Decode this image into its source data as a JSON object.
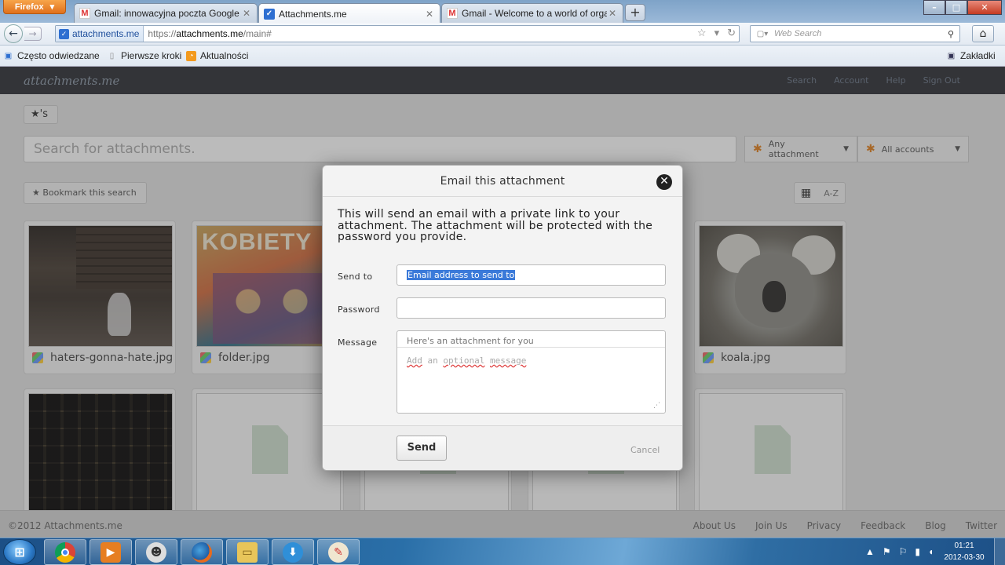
{
  "browser": {
    "menu_label": "Firefox",
    "tabs": [
      {
        "title": "Gmail: innowacyjna poczta Google",
        "favicon": "M"
      },
      {
        "title": "Attachments.me",
        "favicon": "✓"
      },
      {
        "title": "Gmail - Welcome to a world of organ...",
        "favicon": "M"
      }
    ],
    "new_tab": "+",
    "window_buttons": [
      "–",
      "□",
      "✕"
    ],
    "site_identity": "attachments.me",
    "url_prefix": "https://",
    "url_host": "attachments.me",
    "url_path": "/main#",
    "search_placeholder": "Web Search",
    "bookmarks": [
      "Często odwiedzane",
      "Pierwsze kroki",
      "Aktualności"
    ],
    "bookmarks_menu": "Zakładki"
  },
  "site": {
    "logo": "attachments.me",
    "nav": [
      "Search",
      "Account",
      "Help",
      "Sign Out"
    ],
    "crumb": "★'s",
    "search_placeholder": "Search for attachments.",
    "filters": [
      "Any attachment",
      "All accounts"
    ],
    "bookmark_search": "Bookmark this search",
    "sort_label": "A-Z",
    "cards": [
      {
        "name": "haters-gonna-hate.jpg"
      },
      {
        "name": "folder.jpg",
        "poster_text": "KOBIETY"
      },
      {
        "name": "koala.jpg"
      }
    ],
    "copyright": "©2012 Attachments.me",
    "footer_links": [
      "About Us",
      "Join Us",
      "Privacy",
      "Feedback",
      "Blog",
      "Twitter"
    ]
  },
  "modal": {
    "title": "Email this attachment",
    "close_glyph": "✕",
    "description": "This will send an email with a private link to your attachment. The attachment will be protected with the password you provide.",
    "send_to_label": "Send to",
    "send_to_placeholder": "Email address to send to",
    "password_label": "Password",
    "message_label": "Message",
    "message_subject": "Here's an attachment for you",
    "message_words": [
      "Add",
      "an",
      "optional",
      "message"
    ],
    "send_button": "Send",
    "cancel": "Cancel"
  },
  "taskbar": {
    "start_glyph": "⊞",
    "pinned": [
      "chrome-icon",
      "media-player-icon",
      "alien-icon",
      "firefox-icon",
      "explorer-icon",
      "download-icon",
      "paint-icon"
    ],
    "time": "01:21",
    "date": "2012-03-30"
  },
  "colors": {
    "site_header": "#2e3136",
    "accent_orange": "#e08020",
    "selection_blue": "#3b7ad9"
  }
}
